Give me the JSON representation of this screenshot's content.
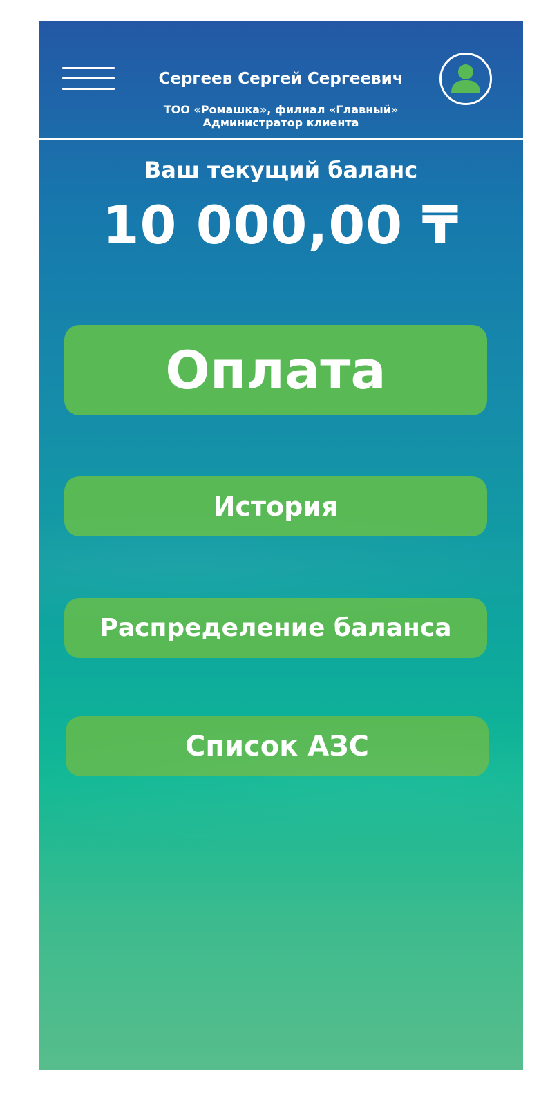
{
  "header": {
    "user_name": "Сергеев Сергей Сергеевич",
    "company": "ТОО «Ромашка», филиал «Главный»",
    "role": "Администратор клиента",
    "menu_icon": "hamburger-menu-icon",
    "avatar_icon": "user-avatar-icon"
  },
  "balance": {
    "label": "Ваш текущий баланс",
    "amount": "10 000,00 ₸"
  },
  "actions": {
    "pay": "Оплата",
    "history": "История",
    "distribution": "Распределение баланса",
    "stations": "Список АЗС"
  },
  "colors": {
    "gradient_top": "#2458a6",
    "gradient_bottom": "#58bd8c",
    "button_green": "#58b955",
    "avatar_green": "#58b955"
  }
}
